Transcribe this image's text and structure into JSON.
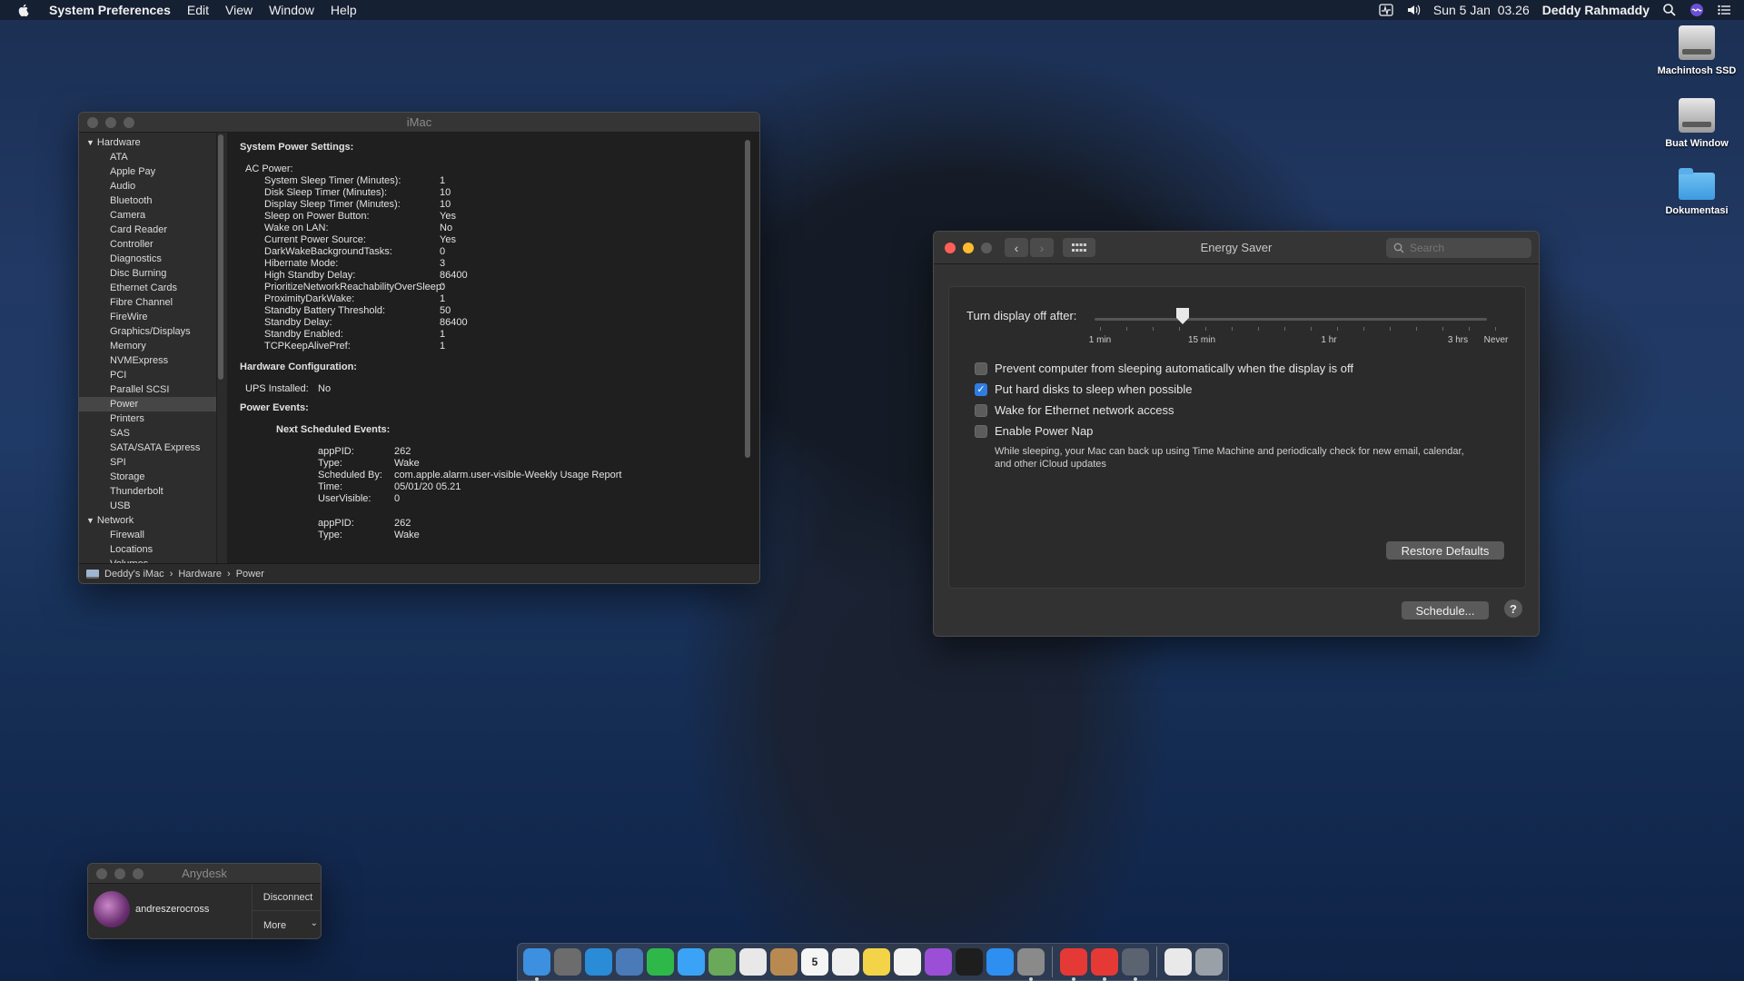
{
  "menubar": {
    "app_name": "System Preferences",
    "menus": [
      "Edit",
      "View",
      "Window",
      "Help"
    ],
    "clock": "Sun 5 Jan  03.26",
    "user": "Deddy Rahmaddy"
  },
  "desktop_icons": [
    {
      "label": "Machintosh SSD",
      "icon": "hard-drive-icon"
    },
    {
      "label": "Buat Window",
      "icon": "hard-drive-icon"
    },
    {
      "label": "Dokumentasi",
      "icon": "folder-icon"
    }
  ],
  "sysinfo": {
    "title": "iMac",
    "sidebar": {
      "hardware_group": "Hardware",
      "hardware_items": [
        "ATA",
        "Apple Pay",
        "Audio",
        "Bluetooth",
        "Camera",
        "Card Reader",
        "Controller",
        "Diagnostics",
        "Disc Burning",
        "Ethernet Cards",
        "Fibre Channel",
        "FireWire",
        "Graphics/Displays",
        "Memory",
        "NVMExpress",
        "PCI",
        "Parallel SCSI",
        "Power",
        "Printers",
        "SAS",
        "SATA/SATA Express",
        "SPI",
        "Storage",
        "Thunderbolt",
        "USB"
      ],
      "selected": "Power",
      "network_group": "Network",
      "network_items": [
        "Firewall",
        "Locations",
        "Volumes"
      ]
    },
    "content": {
      "heading1": "System Power Settings:",
      "ac_power_label": "AC Power:",
      "ac_power": [
        {
          "k": "System Sleep Timer (Minutes):",
          "v": "1"
        },
        {
          "k": "Disk Sleep Timer (Minutes):",
          "v": "10"
        },
        {
          "k": "Display Sleep Timer (Minutes):",
          "v": "10"
        },
        {
          "k": "Sleep on Power Button:",
          "v": "Yes"
        },
        {
          "k": "Wake on LAN:",
          "v": "No"
        },
        {
          "k": "Current Power Source:",
          "v": "Yes"
        },
        {
          "k": "DarkWakeBackgroundTasks:",
          "v": "0"
        },
        {
          "k": "Hibernate Mode:",
          "v": "3"
        },
        {
          "k": "High Standby Delay:",
          "v": "86400"
        },
        {
          "k": "PrioritizeNetworkReachabilityOverSleep:",
          "v": "0"
        },
        {
          "k": "ProximityDarkWake:",
          "v": "1"
        },
        {
          "k": "Standby Battery Threshold:",
          "v": "50"
        },
        {
          "k": "Standby Delay:",
          "v": "86400"
        },
        {
          "k": "Standby Enabled:",
          "v": "1"
        },
        {
          "k": "TCPKeepAlivePref:",
          "v": "1"
        }
      ],
      "heading2": "Hardware Configuration:",
      "ups_label": "UPS Installed:",
      "ups_value": "No",
      "heading3": "Power Events:",
      "next_events_label": "Next Scheduled Events:",
      "event1": [
        {
          "k": "appPID:",
          "v": "262"
        },
        {
          "k": "Type:",
          "v": "Wake"
        },
        {
          "k": "Scheduled By:",
          "v": "com.apple.alarm.user-visible-Weekly Usage Report"
        },
        {
          "k": "Time:",
          "v": "05/01/20 05.21"
        },
        {
          "k": "UserVisible:",
          "v": "0"
        }
      ],
      "event2": [
        {
          "k": "appPID:",
          "v": "262"
        },
        {
          "k": "Type:",
          "v": "Wake"
        }
      ]
    },
    "path": [
      "Deddy's iMac",
      "Hardware",
      "Power"
    ]
  },
  "energy": {
    "title": "Energy Saver",
    "search_placeholder": "Search",
    "slider_label": "Turn display off after:",
    "slider_value_minutes": 10,
    "tick_labels": [
      "1 min",
      "15 min",
      "1 hr",
      "3 hrs",
      "Never"
    ],
    "options": [
      {
        "label": "Prevent computer from sleeping automatically when the display is off",
        "checked": false
      },
      {
        "label": "Put hard disks to sleep when possible",
        "checked": true
      },
      {
        "label": "Wake for Ethernet network access",
        "checked": false
      },
      {
        "label": "Enable Power Nap",
        "checked": false
      }
    ],
    "power_nap_note": "While sleeping, your Mac can back up using Time Machine and periodically check for new email, calendar, and other iCloud updates",
    "restore_defaults": "Restore Defaults",
    "schedule": "Schedule...",
    "help": "?"
  },
  "anydesk": {
    "title": "Anydesk",
    "user": "andreszerocross",
    "disconnect": "Disconnect",
    "more": "More"
  },
  "dock": {
    "apps": [
      {
        "icon": "finder-icon",
        "color": "#3d8fe0",
        "running": true
      },
      {
        "icon": "launchpad-icon",
        "color": "#6c6c6c",
        "running": false
      },
      {
        "icon": "safari-icon",
        "color": "#2a8bd6",
        "running": false
      },
      {
        "icon": "preview-icon",
        "color": "#4a7ab8",
        "running": false
      },
      {
        "icon": "facetime-icon",
        "color": "#2fb84a",
        "running": false
      },
      {
        "icon": "messages-icon",
        "color": "#3aa3f5",
        "running": false
      },
      {
        "icon": "maps-icon",
        "color": "#6aa85a",
        "running": false
      },
      {
        "icon": "photos-icon",
        "color": "#e8e8e8",
        "running": false
      },
      {
        "icon": "contacts-icon",
        "color": "#b88a52",
        "running": false
      },
      {
        "icon": "calendar-icon",
        "color": "#f5f5f5",
        "running": false
      },
      {
        "icon": "reminders-icon",
        "color": "#f0f0f0",
        "running": false
      },
      {
        "icon": "notes-icon",
        "color": "#f3d348",
        "running": false
      },
      {
        "icon": "music-icon",
        "color": "#f2f2f2",
        "running": false
      },
      {
        "icon": "podcasts-icon",
        "color": "#9b4fd6",
        "running": false
      },
      {
        "icon": "tv-icon",
        "color": "#1e1e1e",
        "running": false
      },
      {
        "icon": "app-store-icon",
        "color": "#2d8ff0",
        "running": false
      },
      {
        "icon": "system-preferences-icon",
        "color": "#8a8a8a",
        "running": true
      },
      {
        "icon": "anydesk-icon",
        "color": "#e53935",
        "running": true
      },
      {
        "icon": "anydesk-alt-icon",
        "color": "#e53935",
        "running": true
      },
      {
        "icon": "script-editor-icon",
        "color": "#5b6270",
        "running": true
      },
      {
        "icon": "document-icon",
        "color": "#e9e9e9",
        "running": false
      },
      {
        "icon": "trash-icon",
        "color": "#9aa0a8",
        "running": false
      }
    ],
    "calendar_day": "5"
  }
}
